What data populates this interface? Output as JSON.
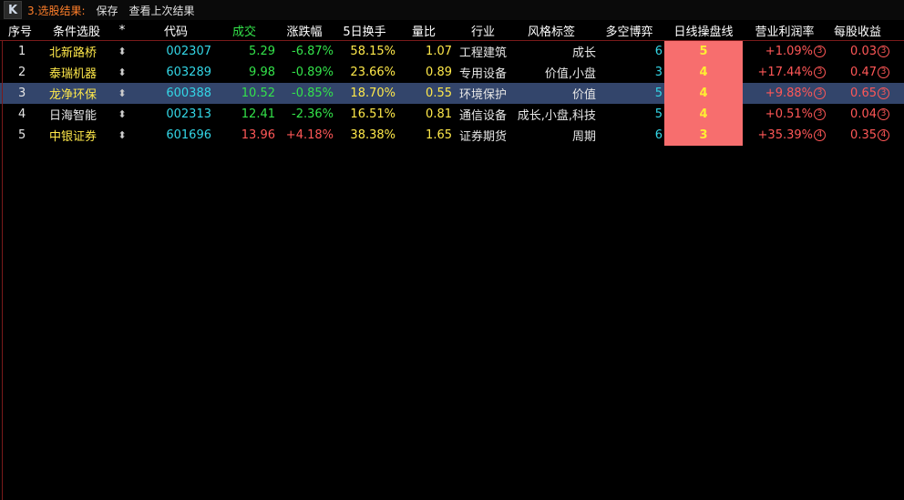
{
  "topbar": {
    "logo": "K",
    "title": "3.选股结果:",
    "save": "保存",
    "view_last": "查看上次结果"
  },
  "headers": {
    "no": "序号",
    "name": "条件选股",
    "star": "*",
    "code": "代码",
    "price": "成交",
    "change": "涨跌幅",
    "turnover": "5日换手",
    "volume_ratio": "量比",
    "industry": "行业",
    "style": "风格标签",
    "long_short": "多空博弈",
    "day_line": "日线操盘线",
    "profit": "营业利润率",
    "eps": "每股收益"
  },
  "rows": [
    {
      "no": "1",
      "name": "北新路桥",
      "star": "⬍",
      "code": "002307",
      "price": "5.29",
      "change": "-6.87%",
      "turnover": "58.15%",
      "vr": "1.07",
      "industry": "工程建筑",
      "style": "成长",
      "ls": "6",
      "day": "5",
      "profit": "+1.09%",
      "profit_rank": "3",
      "eps": "0.03",
      "eps_rank": "3"
    },
    {
      "no": "2",
      "name": "泰瑞机器",
      "star": "⬍",
      "code": "603289",
      "price": "9.98",
      "change": "-0.89%",
      "turnover": "23.66%",
      "vr": "0.89",
      "industry": "专用设备",
      "style": "价值,小盘",
      "ls": "3",
      "day": "4",
      "profit": "+17.44%",
      "profit_rank": "3",
      "eps": "0.47",
      "eps_rank": "3"
    },
    {
      "no": "3",
      "name": "龙净环保",
      "star": "⬍",
      "code": "600388",
      "price": "10.52",
      "change": "-0.85%",
      "turnover": "18.70%",
      "vr": "0.55",
      "industry": "环境保护",
      "style": "价值",
      "ls": "5",
      "day": "4",
      "profit": "+9.88%",
      "profit_rank": "3",
      "eps": "0.65",
      "eps_rank": "3"
    },
    {
      "no": "4",
      "name": "日海智能",
      "star": "⬍",
      "code": "002313",
      "price": "12.41",
      "change": "-2.36%",
      "turnover": "16.51%",
      "vr": "0.81",
      "industry": "通信设备",
      "style": "成长,小盘,科技",
      "ls": "5",
      "day": "4",
      "profit": "+0.51%",
      "profit_rank": "3",
      "eps": "0.04",
      "eps_rank": "3"
    },
    {
      "no": "5",
      "name": "中银证券",
      "star": "⬍",
      "code": "601696",
      "price": "13.96",
      "change": "+4.18%",
      "turnover": "38.38%",
      "vr": "1.65",
      "industry": "证券期货",
      "style": "周期",
      "ls": "6",
      "day": "3",
      "profit": "+35.39%",
      "profit_rank": "4",
      "eps": "0.35",
      "eps_rank": "4"
    }
  ]
}
